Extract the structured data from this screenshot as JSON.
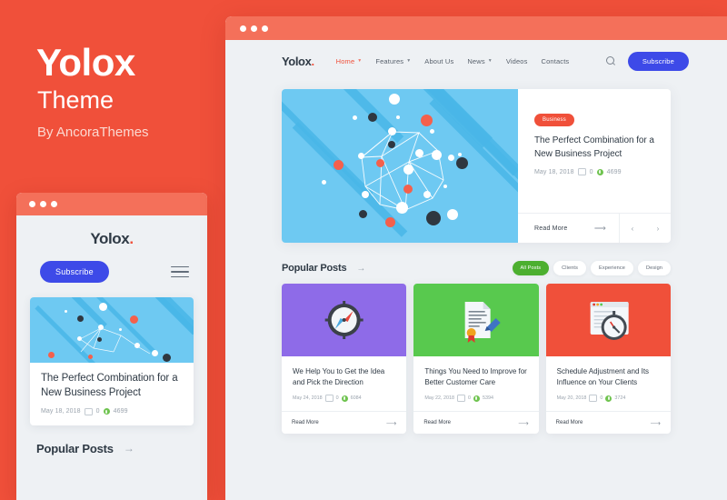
{
  "promo": {
    "title": "Yolox",
    "subtitle": "Theme",
    "author": "By AncoraThemes",
    "background_color": "#F0503A"
  },
  "brand": {
    "logo_text": "Yolox",
    "logo_dot": ".",
    "accent_color": "#F0503A",
    "subscribe_color": "#3D4AE8",
    "filter_active_color": "#4CAF2F"
  },
  "mobile": {
    "window_dots": 3,
    "logo_text": "Yolox",
    "subscribe_label": "Subscribe",
    "menu_icon": "hamburger-icon",
    "card": {
      "title": "The Perfect Combination for a New Business Project",
      "date": "May 18, 2018",
      "comments": "0",
      "views": "4699",
      "thumb_bg": "#6EC9F2",
      "thumb_icon": "network-nodes-illustration"
    },
    "popular_title": "Popular Posts",
    "popular_arrow": "→"
  },
  "desktop": {
    "window_dots": 3,
    "logo_text": "Yolox",
    "nav": [
      {
        "label": "Home",
        "has_dropdown": true,
        "active": true
      },
      {
        "label": "Features",
        "has_dropdown": true,
        "active": false
      },
      {
        "label": "About Us",
        "has_dropdown": false,
        "active": false
      },
      {
        "label": "News",
        "has_dropdown": true,
        "active": false
      },
      {
        "label": "Videos",
        "has_dropdown": false,
        "active": false
      },
      {
        "label": "Contacts",
        "has_dropdown": false,
        "active": false
      }
    ],
    "search_icon": "search-icon",
    "subscribe_label": "Subscribe",
    "hero": {
      "badge": "Business",
      "title": "The Perfect Combination for a New Business Project",
      "date": "May 18, 2018",
      "comments": "0",
      "views": "4699",
      "read_more": "Read More",
      "arrow": "⟶",
      "prev": "‹",
      "next": "›",
      "thumb_bg": "#6EC9F2",
      "thumb_icon": "network-nodes-illustration"
    },
    "popular": {
      "title": "Popular Posts",
      "arrow": "→",
      "filters": [
        {
          "label": "All Posts",
          "active": true
        },
        {
          "label": "Clients",
          "active": false
        },
        {
          "label": "Experience",
          "active": false
        },
        {
          "label": "Design",
          "active": false
        }
      ],
      "cards": [
        {
          "title": "We Help You to Get the Idea and Pick the Direction",
          "date": "May 24, 2018",
          "comments": "0",
          "views": "6084",
          "read_more": "Read More",
          "arrow": "⟶",
          "thumb_bg": "#8E6BE8",
          "thumb_icon": "compass-icon"
        },
        {
          "title": "Things You Need to Improve for Better Customer Care",
          "date": "May 22, 2018",
          "comments": "0",
          "views": "5394",
          "read_more": "Read More",
          "arrow": "⟶",
          "thumb_bg": "#58C94E",
          "thumb_icon": "certificate-pen-icon"
        },
        {
          "title": "Schedule Adjustment and Its Influence on Your Clients",
          "date": "May 20, 2018",
          "comments": "0",
          "views": "3724",
          "read_more": "Read More",
          "arrow": "⟶",
          "thumb_bg": "#F0503A",
          "thumb_icon": "browser-stopwatch-icon"
        }
      ]
    }
  }
}
